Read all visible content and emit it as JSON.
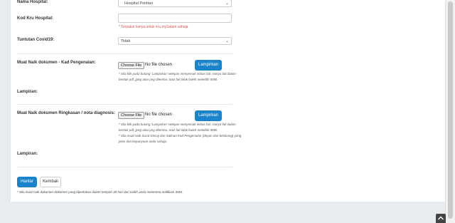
{
  "form": {
    "nama_hospital_label": "Nama Hospital:",
    "nama_hospital_value": "Hospital Pontian",
    "kod_kru_label": "Kod Kru Hospital:",
    "kod_kru_value": "",
    "kod_kru_hint": "* Terpakai hanya untuk kru mySalam sahaja",
    "tuntutan_label": "Tuntutan Covid19:",
    "tuntutan_value": "Tidak",
    "upload_kad_label": "Muat Naik dokumen - Kad Pengenalan:",
    "upload_kad_file_button": "Choose File",
    "upload_kad_file_status": "No file chosen",
    "upload_kad_attach": "Lampirkan",
    "upload_kad_hint_1": "* Sila klik pada butang 'Lampirkan' selepas menyemak imbas fail. Hanya fail dalam",
    "upload_kad_hint_2": "bentuk pdf, jpeg atau png diterima. Saiz fail tidak boleh melebihi 5MB.",
    "lampiran_1_label": "Lampiran:",
    "upload_ringkasan_label": "Muat Naik dokumen Ringkasan / nota diagnosis:",
    "upload_ringkasan_file_button": "Choose File",
    "upload_ringkasan_file_status": "No file chosen",
    "upload_ringkasan_attach": "Lampirkan",
    "upload_ringkasan_hint_1": "* Sila klik pada butang 'Lampirkan' selepas menyemak imbas fail. Hanya fail dalam",
    "upload_ringkasan_hint_2": "bentuk pdf, jpeg atau png diterima. Saiz fail tidak boleh melebihi 5MB.",
    "upload_ringkasan_hint_3": "* Sila muat naik Surat Discaj dan Salinan Kad Pengenalan (depan dan belakang) yang",
    "upload_ringkasan_hint_4": "jelas dan kepunyaan anda sahaja.",
    "lampiran_2_label": "Lampiran:",
    "submit_label": "Hantar",
    "back_label": "Kembali",
    "footer_note": "* Sila muat naik dokumen-dokumen yang diperlukan dalam tempoh 30 hari dari tarikh anda menerima notifikasi SMS."
  },
  "colors": {
    "accent": "#1a83c9",
    "hint_red": "#d9534f",
    "background": "#e9ecef"
  },
  "icons": {
    "select_chevron": "chevron-down-icon",
    "scroll_top": "chevron-up-icon"
  }
}
